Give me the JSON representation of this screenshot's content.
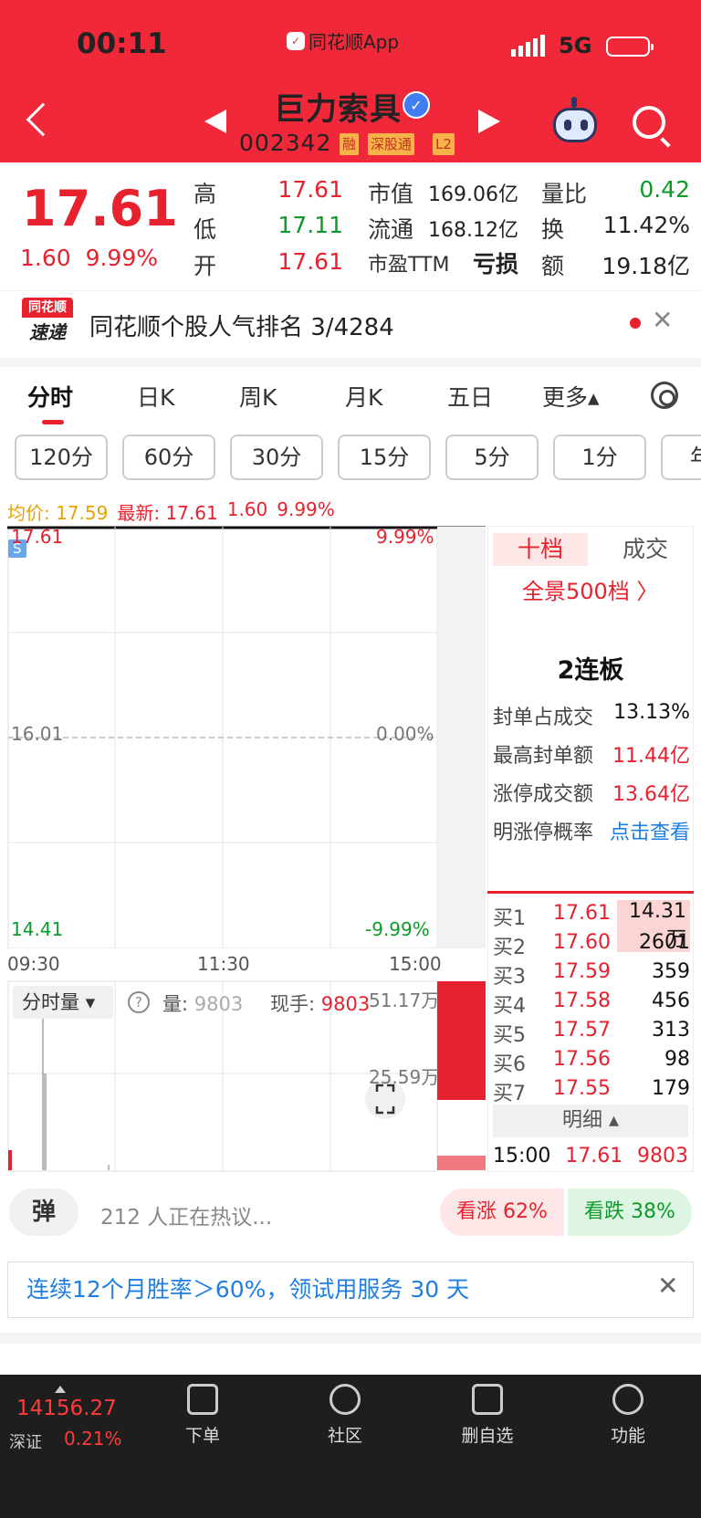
{
  "status": {
    "time": "00:11",
    "app": "同花顺App",
    "network": "5G"
  },
  "header": {
    "name": "巨力索具",
    "code": "002342",
    "tags": [
      "融",
      "深股通",
      "L2"
    ]
  },
  "quote": {
    "price": "17.61",
    "change": "1.60",
    "pct": "9.99%",
    "rows": [
      {
        "l1": "高",
        "v1": "17.61",
        "l2": "市值",
        "v2": "169.06亿",
        "l3": "量比",
        "v3": "0.42"
      },
      {
        "l1": "低",
        "v1": "17.11",
        "l2": "流通",
        "v2": "168.12亿",
        "l3": "换",
        "v3": "11.42%"
      },
      {
        "l1": "开",
        "v1": "17.61",
        "l2": "市盈TTM",
        "v2": "亏损",
        "l3": "额",
        "v3": "19.18亿"
      }
    ]
  },
  "banner": {
    "logo_top": "同花顺",
    "logo_bottom": "速递",
    "text": "同花顺个股人气排名 3/4284",
    "close": "✕"
  },
  "tabs": [
    "分时",
    "日K",
    "周K",
    "月K",
    "五日",
    "更多▴"
  ],
  "periods": [
    "120分",
    "60分",
    "30分",
    "15分",
    "5分",
    "1分",
    "年"
  ],
  "avgline": {
    "avg": "均价: 17.59",
    "latest": "最新: 17.61",
    "chg": "1.60",
    "pct": "9.99%"
  },
  "chart": {
    "top_price": "17.61",
    "top_pct": "9.99%",
    "mid_price": "16.01",
    "mid_pct": "0.00%",
    "low_price": "14.41",
    "low_pct": "-9.99%",
    "s_tag": "S",
    "t1": "09:30",
    "t2": "11:30",
    "t3": "15:00",
    "vol_label": "分时量 ▾",
    "vol_q": "?",
    "vol_amount_label": "量:",
    "vol_amount": "9803",
    "vol_now_label": "现手:",
    "vol_now": "9803",
    "vol_top": "51.17万",
    "vol_mid": "25.59万"
  },
  "orderbook": {
    "tab1": "十档",
    "tab2": "成交",
    "panorama": "全景500档 〉",
    "lianban": "2连板",
    "stats": [
      {
        "l": "封单占成交",
        "v": "13.13%",
        "c": "#111"
      },
      {
        "l": "最高封单额",
        "v": "11.44亿",
        "c": "#e8212e"
      },
      {
        "l": "涨停成交额",
        "v": "13.64亿",
        "c": "#e8212e"
      },
      {
        "l": "明涨停概率",
        "v": "点击查看",
        "c": "#1f7ee0"
      }
    ],
    "bids": [
      {
        "l": "买1",
        "p": "17.61",
        "q": "14.31万"
      },
      {
        "l": "买2",
        "p": "17.60",
        "q": "2601"
      },
      {
        "l": "买3",
        "p": "17.59",
        "q": "359"
      },
      {
        "l": "买4",
        "p": "17.58",
        "q": "456"
      },
      {
        "l": "买5",
        "p": "17.57",
        "q": "313"
      },
      {
        "l": "买6",
        "p": "17.56",
        "q": "98"
      },
      {
        "l": "买7",
        "p": "17.55",
        "q": "179"
      }
    ],
    "detail": "明细 ▴",
    "trade": {
      "t": "15:00",
      "p": "17.61",
      "q": "9803"
    }
  },
  "comments": {
    "danmu": "弹",
    "hot": "212 人正在热议...",
    "up": "看涨 62%",
    "down": "看跌 38%"
  },
  "promo": {
    "text": "连续12个月胜率＞60%，领试用服务 30 天",
    "close": "✕"
  },
  "bottom": {
    "index_value": "14156.27",
    "index_name": "深证",
    "index_pct": "0.21%",
    "nav": [
      "下单",
      "社区",
      "删自选",
      "功能"
    ]
  }
}
